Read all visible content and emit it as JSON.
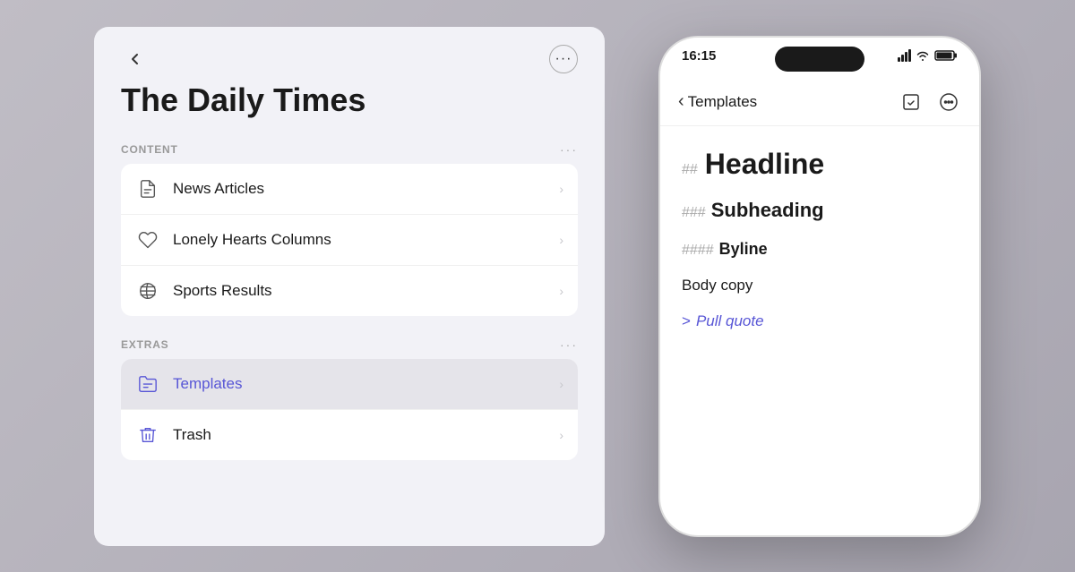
{
  "background_color": "#b0adb5",
  "left_panel": {
    "back_label": "‹",
    "more_label": "···",
    "title": "The Daily Times",
    "sections": [
      {
        "id": "content",
        "label": "CONTENT",
        "more": "···",
        "items": [
          {
            "id": "news-articles",
            "label": "News Articles",
            "icon": "doc",
            "active": false
          },
          {
            "id": "lonely-hearts",
            "label": "Lonely Hearts Columns",
            "icon": "heart",
            "active": false
          },
          {
            "id": "sports-results",
            "label": "Sports Results",
            "icon": "sports",
            "active": false
          }
        ]
      },
      {
        "id": "extras",
        "label": "EXTRAS",
        "more": "···",
        "items": [
          {
            "id": "templates",
            "label": "Templates",
            "icon": "folder",
            "active": true
          },
          {
            "id": "trash",
            "label": "Trash",
            "icon": "trash",
            "active": false
          }
        ]
      }
    ]
  },
  "right_panel": {
    "time": "16:15",
    "nav_back_label": "Templates",
    "content": {
      "headline_prefix": "##",
      "headline": "Headline",
      "subheading_prefix": "###",
      "subheading": "Subheading",
      "byline_prefix": "####",
      "byline": "Byline",
      "body": "Body copy",
      "pull_quote_prefix": ">",
      "pull_quote": "Pull quote"
    }
  }
}
